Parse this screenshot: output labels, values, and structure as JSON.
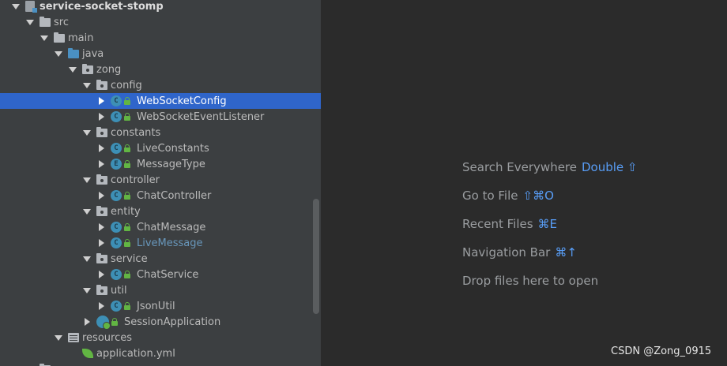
{
  "project_tree": {
    "root": "service-socket-stomp",
    "items": {
      "src": "src",
      "main": "main",
      "java": "java",
      "zong": "zong",
      "config": "config",
      "websocket_config": "WebSocketConfig",
      "websocket_event_listener": "WebSocketEventListener",
      "constants": "constants",
      "live_constants": "LiveConstants",
      "message_type": "MessageType",
      "controller": "controller",
      "chat_controller": "ChatController",
      "entity": "entity",
      "chat_message": "ChatMessage",
      "live_message": "LiveMessage",
      "service": "service",
      "chat_service": "ChatService",
      "util": "util",
      "json_util": "JsonUtil",
      "session_application": "SessionApplication",
      "resources": "resources",
      "application_yml": "application.yml"
    },
    "class_letter": "C",
    "enum_letter": "E",
    "selected": "WebSocketConfig"
  },
  "editor_hints": [
    {
      "label": "Search Everywhere",
      "shortcut": "Double ⇧"
    },
    {
      "label": "Go to File",
      "shortcut": "⇧⌘O"
    },
    {
      "label": "Recent Files",
      "shortcut": "⌘E"
    },
    {
      "label": "Navigation Bar",
      "shortcut": "⌘↑"
    },
    {
      "label": "Drop files here to open",
      "shortcut": ""
    }
  ],
  "watermark": "CSDN @Zong_0915",
  "colors": {
    "selection": "#2f65ca",
    "panel_bg": "#3c3f41",
    "editor_bg": "#2b2b2b",
    "shortcut": "#589df6",
    "class_icon": "#3d8fb5",
    "lock": "#62b543"
  }
}
